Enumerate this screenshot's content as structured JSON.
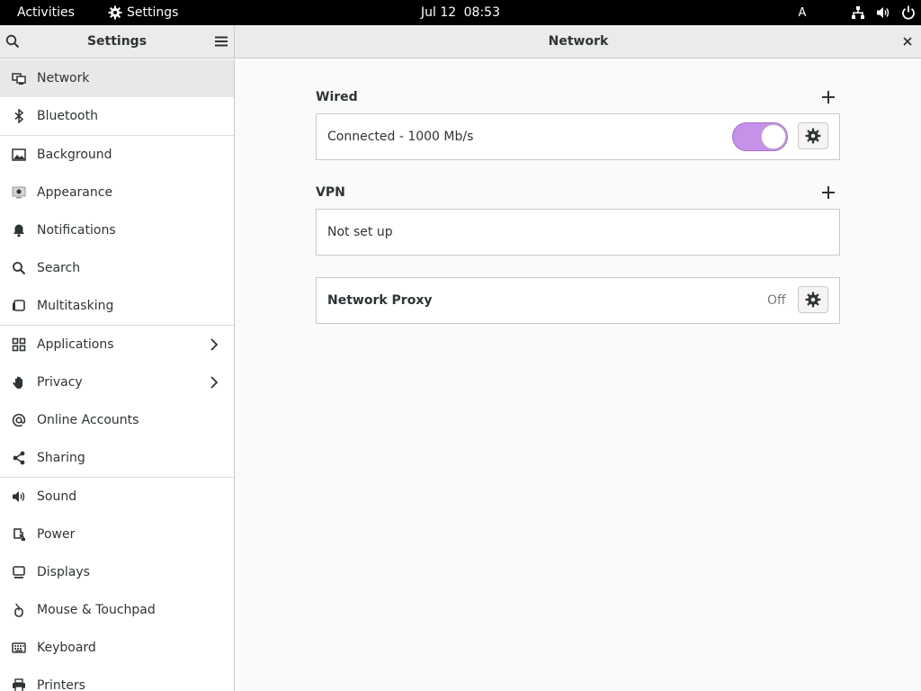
{
  "topbar": {
    "activities": "Activities",
    "app_name": "Settings",
    "date": "Jul 12",
    "time": "08:53",
    "input_source": "A",
    "icons": [
      "network-icon",
      "volume-icon",
      "power-icon"
    ]
  },
  "sidebar": {
    "title": "Settings",
    "items": [
      {
        "label": "Network",
        "icon": "network-icon"
      },
      {
        "label": "Bluetooth",
        "icon": "bluetooth-icon"
      },
      {
        "label": "Background",
        "icon": "background-icon"
      },
      {
        "label": "Appearance",
        "icon": "appearance-icon"
      },
      {
        "label": "Notifications",
        "icon": "bell-icon"
      },
      {
        "label": "Search",
        "icon": "search-icon"
      },
      {
        "label": "Multitasking",
        "icon": "multitasking-icon"
      },
      {
        "label": "Applications",
        "icon": "applications-icon"
      },
      {
        "label": "Privacy",
        "icon": "hand-icon"
      },
      {
        "label": "Online Accounts",
        "icon": "at-icon"
      },
      {
        "label": "Sharing",
        "icon": "share-icon"
      },
      {
        "label": "Sound",
        "icon": "sound-icon"
      },
      {
        "label": "Power",
        "icon": "power-plug-icon"
      },
      {
        "label": "Displays",
        "icon": "display-icon"
      },
      {
        "label": "Mouse & Touchpad",
        "icon": "mouse-icon"
      },
      {
        "label": "Keyboard",
        "icon": "keyboard-icon"
      },
      {
        "label": "Printers",
        "icon": "printer-icon"
      }
    ]
  },
  "main": {
    "title": "Network",
    "wired": {
      "heading": "Wired",
      "status": "Connected - 1000 Mb/s",
      "enabled": true
    },
    "vpn": {
      "heading": "VPN",
      "status": "Not set up"
    },
    "proxy": {
      "label": "Network Proxy",
      "state": "Off"
    }
  },
  "colors": {
    "accent": "#c691e8",
    "topbar_bg": "#000000",
    "selected_row": "#e8e8e7"
  }
}
